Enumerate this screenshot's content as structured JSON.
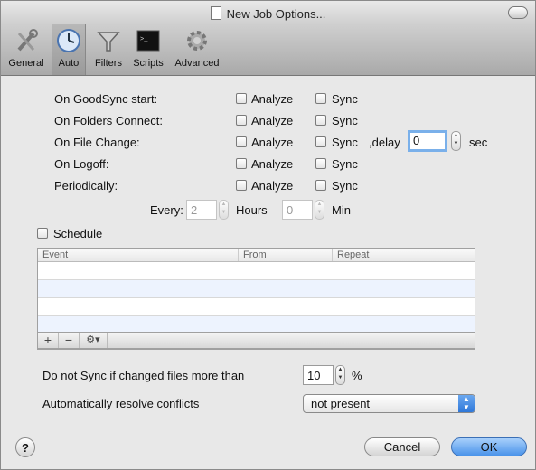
{
  "window": {
    "title": "New Job Options..."
  },
  "toolbar": {
    "items": [
      {
        "label": "General",
        "icon": "wrench-screwdriver-icon"
      },
      {
        "label": "Auto",
        "icon": "clock-icon",
        "selected": true
      },
      {
        "label": "Filters",
        "icon": "funnel-icon"
      },
      {
        "label": "Scripts",
        "icon": "terminal-icon"
      },
      {
        "label": "Advanced",
        "icon": "gear-icon"
      }
    ]
  },
  "auto": {
    "rows": [
      {
        "label": "On GoodSync start:",
        "analyze": "Analyze",
        "sync": "Sync"
      },
      {
        "label": "On Folders Connect:",
        "analyze": "Analyze",
        "sync": "Sync"
      },
      {
        "label": "On File Change:",
        "analyze": "Analyze",
        "sync": "Sync"
      },
      {
        "label": "On Logoff:",
        "analyze": "Analyze",
        "sync": "Sync"
      },
      {
        "label": "Periodically:",
        "analyze": "Analyze",
        "sync": "Sync"
      }
    ],
    "delay_label": ",delay",
    "delay_value": "0",
    "delay_unit": "sec",
    "every_label": "Every:",
    "every_value": "2",
    "hours_label": "Hours",
    "min_value": "0",
    "min_label": "Min"
  },
  "schedule": {
    "label": "Schedule",
    "columns": [
      "Event",
      "From",
      "Repeat"
    ],
    "footer_buttons": [
      "+",
      "−",
      "⚙▾"
    ]
  },
  "options": {
    "no_sync_label": "Do not Sync if changed files more than",
    "no_sync_value": "10",
    "no_sync_unit": "%",
    "resolve_label": "Automatically resolve conflicts",
    "resolve_value": "not present"
  },
  "buttons": {
    "help": "?",
    "cancel": "Cancel",
    "ok": "OK"
  }
}
